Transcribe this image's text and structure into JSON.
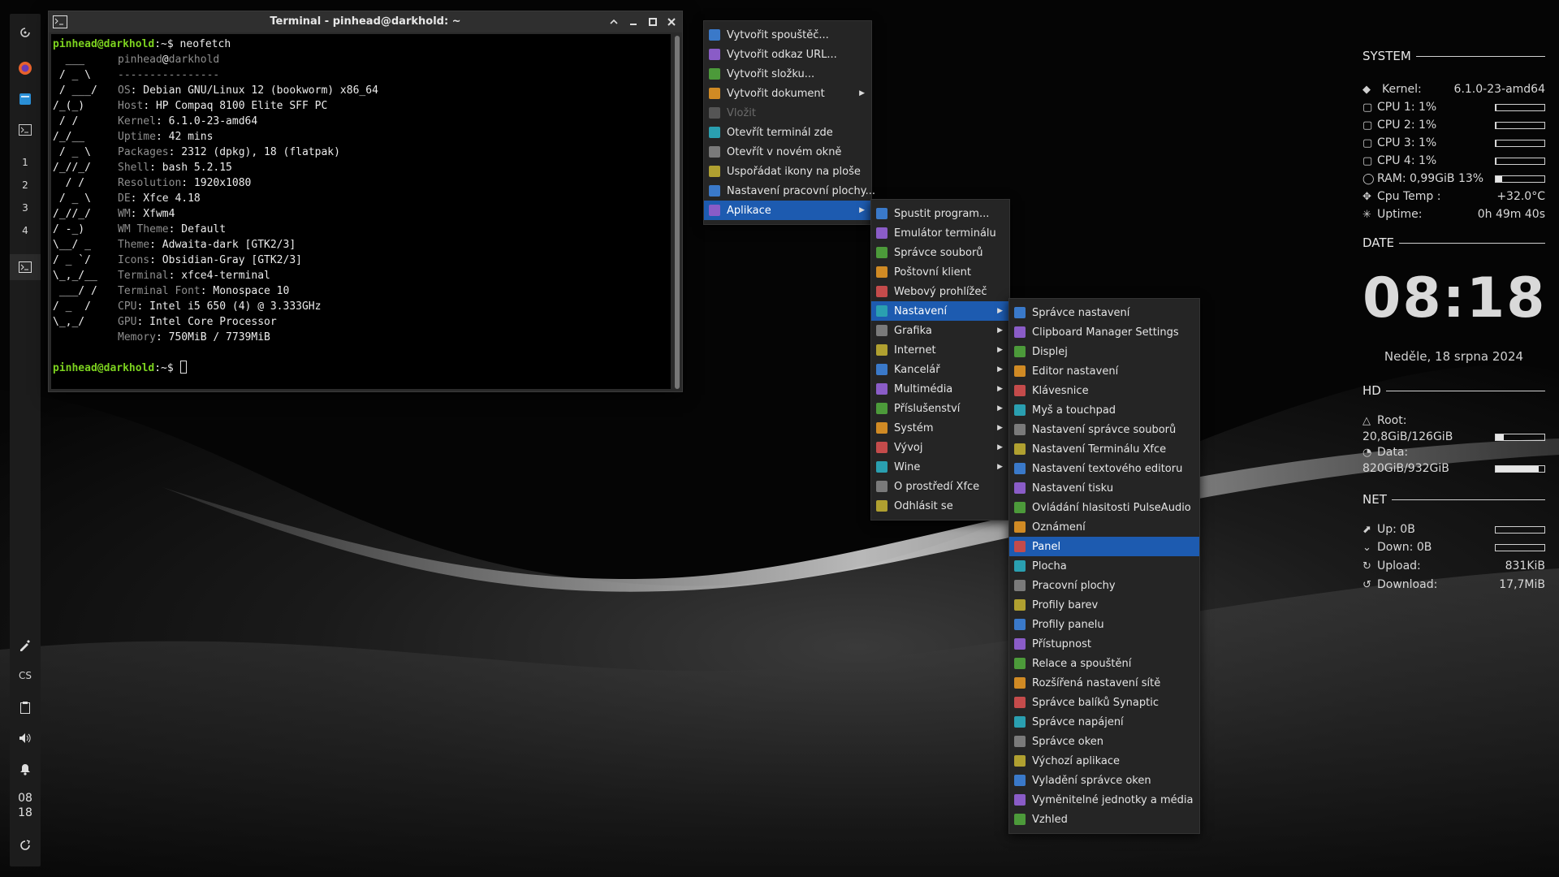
{
  "terminal": {
    "title": "Terminal - pinhead@darkhold: ~",
    "prompt": "pinhead@darkhold",
    "prompt_suffix": ":~$ ",
    "command": "neofetch",
    "user_host_user": "pinhead",
    "user_host_at": "@",
    "user_host_host": "darkhold",
    "dashes": "----------------",
    "ascii": [
      "  ___",
      " / _ \\",
      " / ___/",
      "/_(_)",
      " / /",
      "/_/__",
      " / _ \\",
      "/_//_/",
      "  / /",
      " / _ \\",
      "/_//_/",
      "/ -_)",
      "\\__/ _",
      "/ _ `/",
      "\\_,_/__",
      " ___/ /",
      "/ _  /",
      "\\_,_/",
      ""
    ],
    "info": [
      {
        "key": "OS",
        "value": "Debian GNU/Linux 12 (bookworm) x86_64"
      },
      {
        "key": "Host",
        "value": "HP Compaq 8100 Elite SFF PC"
      },
      {
        "key": "Kernel",
        "value": "6.1.0-23-amd64"
      },
      {
        "key": "Uptime",
        "value": "42 mins"
      },
      {
        "key": "Packages",
        "value": "2312 (dpkg), 18 (flatpak)"
      },
      {
        "key": "Shell",
        "value": "bash 5.2.15"
      },
      {
        "key": "Resolution",
        "value": "1920x1080"
      },
      {
        "key": "DE",
        "value": "Xfce 4.18"
      },
      {
        "key": "WM",
        "value": "Xfwm4"
      },
      {
        "key": "WM Theme",
        "value": "Default"
      },
      {
        "key": "Theme",
        "value": "Adwaita-dark [GTK2/3]"
      },
      {
        "key": "Icons",
        "value": "Obsidian-Gray [GTK2/3]"
      },
      {
        "key": "Terminal",
        "value": "xfce4-terminal"
      },
      {
        "key": "Terminal Font",
        "value": "Monospace 10"
      },
      {
        "key": "CPU",
        "value": "Intel i5 650 (4) @ 3.333GHz"
      },
      {
        "key": "GPU",
        "value": "Intel Core Processor"
      },
      {
        "key": "Memory",
        "value": "750MiB / 7739MiB"
      }
    ]
  },
  "panel": {
    "workspaces": [
      "1",
      "2",
      "3",
      "4"
    ],
    "keyboard_layout": "CS",
    "clock_hour": "08",
    "clock_min": "18"
  },
  "desktop_menu": {
    "items": [
      {
        "label": "Vytvořit spouštěč...",
        "icon": "launcher-icon"
      },
      {
        "label": "Vytvořit odkaz URL...",
        "icon": "link-icon"
      },
      {
        "label": "Vytvořit složku...",
        "icon": "folder-icon"
      },
      {
        "label": "Vytvořit dokument",
        "icon": "document-icon",
        "submenu": true
      },
      {
        "label": "Vložit",
        "icon": "paste-icon",
        "disabled": true
      },
      {
        "label": "Otevřít terminál zde",
        "icon": "terminal-icon"
      },
      {
        "label": "Otevřít v novém okně",
        "icon": "window-icon"
      },
      {
        "label": "Uspořádat ikony na ploše",
        "icon": "arrange-icon"
      },
      {
        "label": "Nastavení pracovní plochy...",
        "icon": "desktop-settings-icon"
      },
      {
        "label": "Aplikace",
        "icon": "applications-icon",
        "submenu": true,
        "highlighted": true
      }
    ]
  },
  "apps_menu": {
    "items": [
      {
        "label": "Spustit program...",
        "icon": "run-icon"
      },
      {
        "label": "Emulátor terminálu",
        "icon": "terminal-icon"
      },
      {
        "label": "Správce souborů",
        "icon": "file-manager-icon"
      },
      {
        "label": "Poštovní klient",
        "icon": "mail-icon"
      },
      {
        "label": "Webový prohlížeč",
        "icon": "browser-icon"
      },
      {
        "label": "Nastavení",
        "icon": "settings-icon",
        "submenu": true,
        "highlighted": true
      },
      {
        "label": "Grafika",
        "icon": "graphics-icon",
        "submenu": true
      },
      {
        "label": "Internet",
        "icon": "internet-icon",
        "submenu": true
      },
      {
        "label": "Kancelář",
        "icon": "office-icon",
        "submenu": true
      },
      {
        "label": "Multimédia",
        "icon": "multimedia-icon",
        "submenu": true
      },
      {
        "label": "Příslušenství",
        "icon": "accessories-icon",
        "submenu": true
      },
      {
        "label": "Systém",
        "icon": "system-icon",
        "submenu": true
      },
      {
        "label": "Vývoj",
        "icon": "development-icon",
        "submenu": true
      },
      {
        "label": "Wine",
        "icon": "wine-icon",
        "submenu": true
      },
      {
        "label": "O prostředí Xfce",
        "icon": "about-icon"
      },
      {
        "label": "Odhlásit se",
        "icon": "logout-icon"
      }
    ]
  },
  "settings_menu": {
    "items": [
      {
        "label": "Správce nastavení",
        "icon": "settings-manager-icon"
      },
      {
        "label": "Clipboard Manager Settings",
        "icon": "clipboard-icon"
      },
      {
        "label": "Displej",
        "icon": "display-icon"
      },
      {
        "label": "Editor nastavení",
        "icon": "settings-editor-icon"
      },
      {
        "label": "Klávesnice",
        "icon": "keyboard-icon"
      },
      {
        "label": "Myš a touchpad",
        "icon": "mouse-icon"
      },
      {
        "label": "Nastavení správce souborů",
        "icon": "file-manager-settings-icon"
      },
      {
        "label": "Nastavení Terminálu Xfce",
        "icon": "terminal-settings-icon"
      },
      {
        "label": "Nastavení textového editoru",
        "icon": "text-editor-icon"
      },
      {
        "label": "Nastavení tisku",
        "icon": "printer-icon"
      },
      {
        "label": "Ovládání hlasitosti PulseAudio",
        "icon": "volume-control-icon"
      },
      {
        "label": "Oznámení",
        "icon": "notification-icon"
      },
      {
        "label": "Panel",
        "icon": "panel-icon",
        "highlighted": true
      },
      {
        "label": "Plocha",
        "icon": "desktop-icon"
      },
      {
        "label": "Pracovní plochy",
        "icon": "workspaces-icon"
      },
      {
        "label": "Profily barev",
        "icon": "color-profiles-icon"
      },
      {
        "label": "Profily panelu",
        "icon": "panel-profiles-icon"
      },
      {
        "label": "Přístupnost",
        "icon": "accessibility-icon"
      },
      {
        "label": "Relace a spouštění",
        "icon": "session-icon"
      },
      {
        "label": "Rozšířená nastavení sítě",
        "icon": "network-icon"
      },
      {
        "label": "Správce balíků Synaptic",
        "icon": "synaptic-icon"
      },
      {
        "label": "Správce napájení",
        "icon": "power-icon"
      },
      {
        "label": "Správce oken",
        "icon": "window-manager-icon"
      },
      {
        "label": "Výchozí aplikace",
        "icon": "default-apps-icon"
      },
      {
        "label": "Vyladění správce oken",
        "icon": "wm-tweaks-icon"
      },
      {
        "label": "Vyměnitelné jednotky a média",
        "icon": "removable-media-icon"
      },
      {
        "label": "Vzhled",
        "icon": "appearance-icon"
      }
    ]
  },
  "conky": {
    "system_header": "SYSTEM",
    "kernel_label": "Kernel:",
    "kernel_value": "6.1.0-23-amd64",
    "cpus": [
      {
        "label": "CPU 1: 1%",
        "level": 0.01
      },
      {
        "label": "CPU 2: 1%",
        "level": 0.01
      },
      {
        "label": "CPU 3: 1%",
        "level": 0.01
      },
      {
        "label": "CPU 4: 1%",
        "level": 0.01
      }
    ],
    "ram_label": "RAM: 0,99GiB 13%",
    "ram_level": 0.13,
    "cpu_temp_label": "Cpu Temp :",
    "cpu_temp_value": "+32.0°C",
    "uptime_label": "Uptime:",
    "uptime_value": "0h 49m 40s",
    "date_header": "DATE",
    "clock": "08:18",
    "date": "Neděle, 18 srpna 2024",
    "hd_header": "HD",
    "root_label": "Root:",
    "root_value": "20,8GiB/126GiB",
    "root_level": 0.17,
    "data_label": "Data:",
    "data_value": "820GiB/932GiB",
    "data_level": 0.88,
    "net_header": "NET",
    "up_label": "Up: 0B",
    "up_level": 0,
    "down_label": "Down: 0B",
    "down_level": 0,
    "upload_label": "Upload:",
    "upload_value": "831KiB",
    "download_label": "Download:",
    "download_value": "17,7MiB"
  },
  "colors": {
    "highlight": "#1d5bb0",
    "prompt": "#7cd21f",
    "menu_bg": "#252525"
  }
}
